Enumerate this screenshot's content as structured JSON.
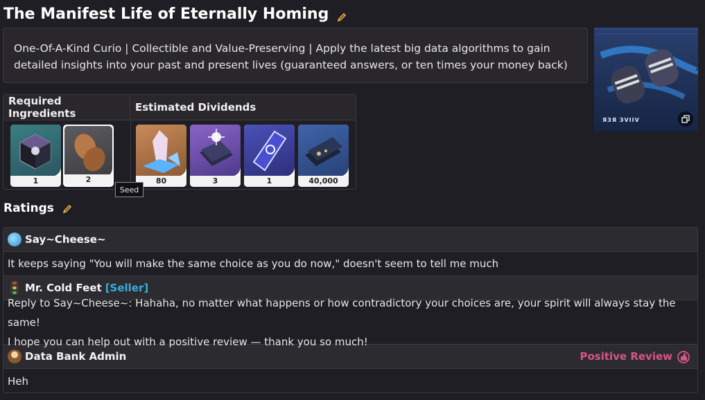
{
  "header": {
    "title": "The Manifest Life of Eternally Homing",
    "edit_icon": "pencil-icon"
  },
  "description": "One-Of-A-Kind Curio | Collectible and Value-Preserving | Apply the latest big data algorithms to gain detailed insights into your past and present lives (guaranteed answers, or ten times your money back)",
  "thumbnail": {
    "caption": "ЯЗЯ ЗVIIV",
    "expand_icon": "expand-icon"
  },
  "ingredients": {
    "required_header": "Required Ingredients",
    "dividends_header": "Estimated Dividends",
    "required": [
      {
        "icon": "cube-icon",
        "qty": "1"
      },
      {
        "icon": "seed-icon",
        "qty": "2",
        "selected": true
      }
    ],
    "dividends": [
      {
        "icon": "crystal-icon",
        "qty": "80"
      },
      {
        "icon": "book-icon",
        "qty": "3"
      },
      {
        "icon": "pass-icon",
        "qty": "1"
      },
      {
        "icon": "credit-cards-icon",
        "qty": "40,000"
      }
    ],
    "tooltip": "Seed"
  },
  "ratings": {
    "title": "Ratings",
    "reviews": [
      {
        "author": "Say~Cheese~",
        "avatar": "blue-ball-avatar",
        "text": "It keeps saying \"You will make the same choice as you do now,\" doesn't seem to tell me much"
      },
      {
        "author": "Mr. Cold Feet",
        "seller_tag": "[Seller]",
        "avatar": "traffic-light-avatar",
        "text_lines": [
          "Reply to Say~Cheese~: Hahaha, no matter what happens or how contradictory your choices are, your spirit will always stay the same!",
          "I hope you can help out with a positive review — thank you so much!"
        ]
      },
      {
        "author": "Data Bank Admin",
        "avatar": "admin-avatar",
        "badge": "Positive Review",
        "text": "Heh"
      }
    ]
  },
  "colors": {
    "background": "#1f1e24",
    "seller": "#34aee0",
    "positive": "#d8548c"
  }
}
